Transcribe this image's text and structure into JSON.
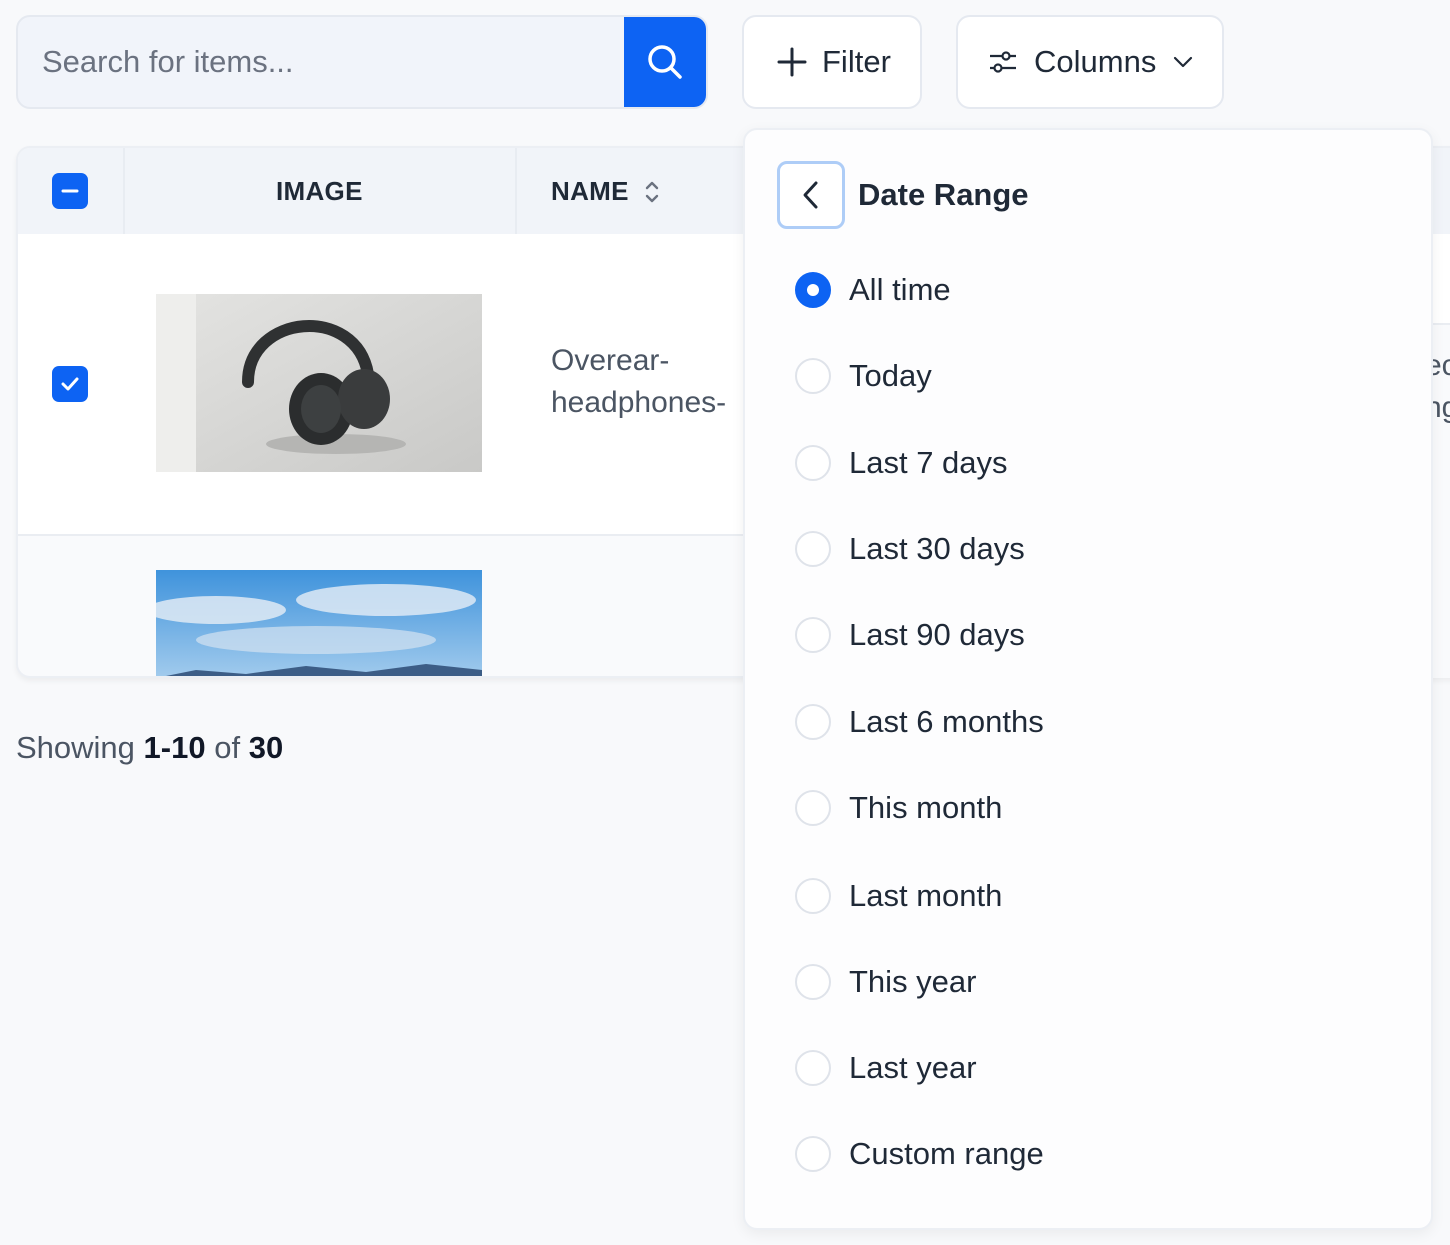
{
  "toolbar": {
    "search_placeholder": "Search for items...",
    "filter_label": "Filter",
    "columns_label": "Columns"
  },
  "table": {
    "columns": [
      "IMAGE",
      "NAME"
    ],
    "rows": [
      {
        "name": "Overear-headphones-",
        "name_line1": "Overear-",
        "name_line2": "headphones-",
        "selected": true,
        "image": "headphones photo"
      },
      {
        "name": "",
        "selected": false,
        "image": "sky and mountains photo"
      }
    ],
    "peek_line1": "ec",
    "peek_line2": "ng"
  },
  "pagination": {
    "prefix": "Showing",
    "range": "1-10",
    "of": "of",
    "total": "30"
  },
  "date_range": {
    "title": "Date Range",
    "selected": "All time",
    "options": [
      "All time",
      "Today",
      "Last 7 days",
      "Last 30 days",
      "Last 90 days",
      "Last 6 months",
      "This month",
      "Last month",
      "This year",
      "Last year",
      "Custom range"
    ]
  },
  "colors": {
    "accent": "#0d63f3",
    "back_button_border": "#aecdf7",
    "background": "#f8f9fb"
  }
}
